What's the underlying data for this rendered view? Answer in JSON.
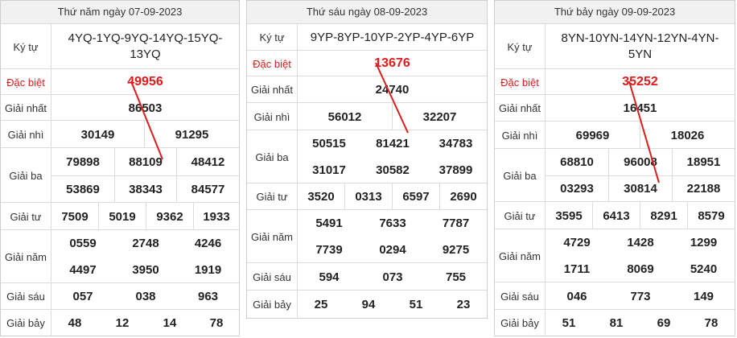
{
  "accent_color": "#e01b1b",
  "row_labels": {
    "ky_tu": "Ký tự",
    "dac_biet": "Đặc biệt",
    "giai_nhat": "Giải nhất",
    "giai_nhi": "Giải nhì",
    "giai_ba": "Giải ba",
    "giai_tu": "Giải tư",
    "giai_nam": "Giải năm",
    "giai_sau": "Giải sáu",
    "giai_bay": "Giải bảy"
  },
  "tables": [
    {
      "title": "Thứ năm ngày 07-09-2023",
      "ky_tu": "4YQ-1YQ-9YQ-14YQ-15YQ-\n13YQ",
      "dac_biet": "49956",
      "giai_nhat": "86503",
      "giai_nhi": [
        "30149",
        "91295"
      ],
      "giai_ba": [
        "79898",
        "88109",
        "48412",
        "53869",
        "38343",
        "84577"
      ],
      "giai_tu": [
        "7509",
        "5019",
        "9362",
        "1933"
      ],
      "giai_nam": [
        "0559",
        "2748",
        "4246",
        "4497",
        "3950",
        "1919"
      ],
      "giai_sau": [
        "057",
        "038",
        "963"
      ],
      "giai_bay": [
        "48",
        "12",
        "14",
        "78"
      ]
    },
    {
      "title": "Thứ sáu ngày 08-09-2023",
      "ky_tu": "9YP-8YP-10YP-2YP-4YP-6YP",
      "dac_biet": "13676",
      "giai_nhat": "24740",
      "giai_nhi": [
        "56012",
        "32207"
      ],
      "giai_ba": [
        "50515",
        "81421",
        "34783",
        "31017",
        "30582",
        "37899"
      ],
      "giai_tu": [
        "3520",
        "0313",
        "6597",
        "2690"
      ],
      "giai_nam": [
        "5491",
        "7633",
        "7787",
        "7739",
        "0294",
        "9275"
      ],
      "giai_sau": [
        "594",
        "073",
        "755"
      ],
      "giai_bay": [
        "25",
        "94",
        "51",
        "23"
      ]
    },
    {
      "title": "Thứ bảy ngày 09-09-2023",
      "ky_tu": "8YN-10YN-14YN-12YN-4YN-\n5YN",
      "dac_biet": "35252",
      "giai_nhat": "16451",
      "giai_nhi": [
        "69969",
        "18026"
      ],
      "giai_ba": [
        "68810",
        "96008",
        "18951",
        "03293",
        "30814",
        "22188"
      ],
      "giai_tu": [
        "3595",
        "6413",
        "8291",
        "8579"
      ],
      "giai_nam": [
        "4729",
        "1428",
        "1299",
        "1711",
        "8069",
        "5240"
      ],
      "giai_sau": [
        "046",
        "773",
        "149"
      ],
      "giai_bay": [
        "51",
        "81",
        "69",
        "78"
      ]
    }
  ]
}
